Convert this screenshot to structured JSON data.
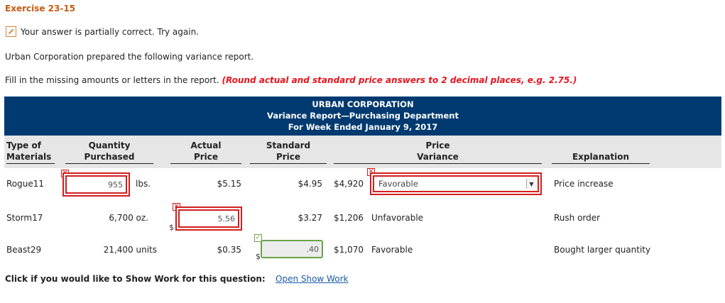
{
  "exercise_title": "Exercise 23-15",
  "status_message": "Your answer is partially correct.  Try again.",
  "intro": "Urban Corporation prepared the following variance report.",
  "instructions": "Fill in the missing amounts or letters in the report.",
  "rounding_note": "(Round actual and standard price answers to 2 decimal places, e.g. 2.75.)",
  "report": {
    "company": "URBAN CORPORATION",
    "title": "Variance Report—Purchasing Department",
    "period": "For Week Ended January 9, 2017"
  },
  "headers": {
    "type_line1": "Type of",
    "type_line2": "Materials",
    "qty_line1": "Quantity",
    "qty_line2": "Purchased",
    "actual_line1": "Actual",
    "actual_line2": "Price",
    "std_line1": "Standard",
    "std_line2": "Price",
    "pv_line1": "Price",
    "pv_line2": "Variance",
    "explanation": "Explanation"
  },
  "rows": [
    {
      "material": "Rogue11",
      "quantity_input": "955",
      "quantity_unit": "lbs.",
      "actual_price": "$5.15",
      "standard_price": "$4.95",
      "variance_amount": "$4,920",
      "variance_select": "Favorable",
      "explanation": "Price increase"
    },
    {
      "material": "Storm17",
      "quantity": "6,700 oz.",
      "actual_price_prefix": "$",
      "actual_price_input": "5.56",
      "standard_price": "$3.27",
      "variance_amount": "$1,206",
      "variance_type": "Unfavorable",
      "explanation": "Rush order"
    },
    {
      "material": "Beast29",
      "quantity": "21,400 units",
      "actual_price": "$0.35",
      "standard_price_prefix": "$",
      "standard_price_input": ".40",
      "variance_amount": "$1,070",
      "variance_type": "Favorable",
      "explanation": "Bought larger quantity"
    }
  ],
  "show_work_prompt": "Click if you would like to Show Work for this question:",
  "show_work_link": "Open Show Work",
  "colors": {
    "title": "#c75b12",
    "banner": "#003a70",
    "error": "#d21f1f",
    "correct": "#6aa34a",
    "note": "#e8141e",
    "link": "#1a5aa8"
  }
}
